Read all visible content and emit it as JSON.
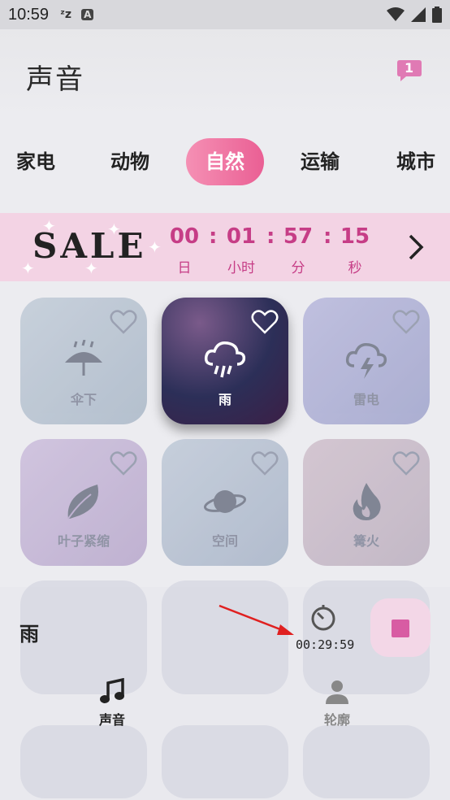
{
  "status_bar": {
    "time": "10:59",
    "icons": [
      "sleep-zz-icon",
      "a-badge-icon",
      "wifi-icon",
      "signal-icon",
      "battery-icon"
    ]
  },
  "header": {
    "title": "声音",
    "notification_count": "1"
  },
  "tabs": [
    {
      "label": "家电",
      "active": false
    },
    {
      "label": "动物",
      "active": false
    },
    {
      "label": "自然",
      "active": true
    },
    {
      "label": "运输",
      "active": false
    },
    {
      "label": "城市",
      "active": false
    }
  ],
  "sale": {
    "word": "SALE",
    "countdown": [
      {
        "value": "00",
        "unit": "日"
      },
      {
        "value": "01",
        "unit": "小时"
      },
      {
        "value": "57",
        "unit": "分"
      },
      {
        "value": "15",
        "unit": "秒"
      }
    ]
  },
  "sounds": [
    {
      "label": "伞下",
      "icon": "umbrella-rain-icon"
    },
    {
      "label": "雨",
      "icon": "cloud-rain-icon",
      "active": true
    },
    {
      "label": "雷电",
      "icon": "cloud-lightning-icon"
    },
    {
      "label": "叶子紧缩",
      "icon": "leaf-icon"
    },
    {
      "label": "空间",
      "icon": "planet-icon"
    },
    {
      "label": "篝火",
      "icon": "fire-icon"
    }
  ],
  "player": {
    "now_playing": "雨",
    "timer": "00:29:59"
  },
  "bottom_nav": [
    {
      "label": "声音",
      "icon": "music-note-icon",
      "active": true
    },
    {
      "label": "轮廓",
      "icon": "person-icon",
      "active": false
    }
  ],
  "colors": {
    "accent": "#ea5f94",
    "sale_bg": "#f3d3e4",
    "countdown": "#c63d86"
  }
}
